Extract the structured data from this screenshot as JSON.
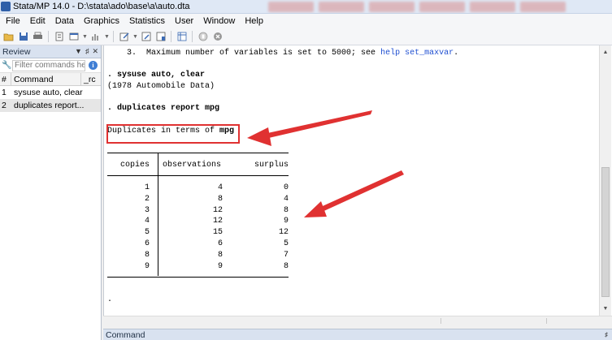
{
  "window": {
    "title": "Stata/MP 14.0 - D:\\stata\\ado\\base\\a\\auto.dta"
  },
  "menu": [
    "File",
    "Edit",
    "Data",
    "Graphics",
    "Statistics",
    "User",
    "Window",
    "Help"
  ],
  "toolbar": {
    "icons": [
      "open-icon",
      "save-icon",
      "print-icon",
      "log-icon",
      "viewer-icon",
      "graph-icon",
      "do-file-editor-icon",
      "data-editor-icon",
      "data-browser-icon",
      "variables-manager-icon",
      "more-icon",
      "break-icon"
    ]
  },
  "review": {
    "title": "Review",
    "filter_placeholder": "Filter commands he",
    "col_num": "#",
    "col_command": "Command",
    "col_rc": "_rc",
    "items": [
      {
        "num": "1",
        "command": "sysuse auto, clear"
      },
      {
        "num": "2",
        "command": "duplicates report..."
      }
    ]
  },
  "results": {
    "note_line": "    3.  Maximum number of variables is set to 5000; see ",
    "note_link1": "help",
    "note_link2": "set_maxvar",
    "note_end": ".",
    "cmd1": ". sysuse auto, clear",
    "out1": "(1978 Automobile Data)",
    "cmd2": ". duplicates report mpg",
    "dup_prefix": "Duplicates in terms of ",
    "dup_var": "mpg",
    "table": {
      "headers": [
        "copies",
        "observations",
        "surplus"
      ],
      "rows": [
        [
          "1",
          "4",
          "0"
        ],
        [
          "2",
          "8",
          "4"
        ],
        [
          "3",
          "12",
          "8"
        ],
        [
          "4",
          "12",
          "9"
        ],
        [
          "5",
          "15",
          "12"
        ],
        [
          "6",
          "6",
          "5"
        ],
        [
          "8",
          "8",
          "7"
        ],
        [
          "9",
          "9",
          "8"
        ]
      ]
    },
    "prompt": "."
  },
  "command_pane": {
    "title": "Command"
  },
  "colors": {
    "annotation": "#e03131",
    "link": "#1f4fd1",
    "panel_header": "#d9e2f0"
  }
}
